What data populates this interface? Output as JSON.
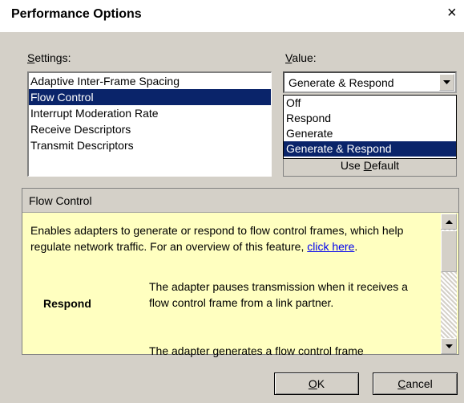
{
  "dialog": {
    "title": "Performance Options",
    "close_glyph": "×"
  },
  "settings": {
    "label_mnemonic": "S",
    "label_rest": "ettings:",
    "items": [
      {
        "label": "Adaptive Inter-Frame Spacing",
        "selected": false
      },
      {
        "label": "Flow Control",
        "selected": true
      },
      {
        "label": "Interrupt Moderation Rate",
        "selected": false
      },
      {
        "label": "Receive Descriptors",
        "selected": false
      },
      {
        "label": "Transmit Descriptors",
        "selected": false
      }
    ]
  },
  "value": {
    "label_mnemonic": "V",
    "label_rest": "alue:",
    "selected": "Generate & Respond",
    "options": [
      {
        "label": "Off",
        "selected": false
      },
      {
        "label": "Respond",
        "selected": false
      },
      {
        "label": "Generate",
        "selected": false
      },
      {
        "label": "Generate & Respond",
        "selected": true
      }
    ],
    "use_default_prefix": "Use ",
    "use_default_mnemonic": "D",
    "use_default_rest": "efault"
  },
  "description": {
    "header": "Flow Control",
    "text_before_link": "Enables adapters to generate or respond to flow control frames, which help regulate network traffic. For an overview of this feature, ",
    "link_text": "click here",
    "text_after_link": ".",
    "term": "Respond",
    "term_definition": "The adapter pauses transmission when it receives a flow control frame from a link partner.",
    "next_definition": "The adapter generates a flow control frame"
  },
  "buttons": {
    "ok_mnemonic": "O",
    "ok_rest": "K",
    "cancel_mnemonic": "C",
    "cancel_rest": "ancel"
  },
  "colors": {
    "selection": "#0a246a",
    "dialog_bg": "#d4d0c8",
    "description_bg": "#ffffc0"
  },
  "icons": {
    "dropdown_arrow": "chevron-down-icon",
    "scroll_up": "scroll-up-arrow-icon",
    "scroll_down": "scroll-down-arrow-icon"
  }
}
